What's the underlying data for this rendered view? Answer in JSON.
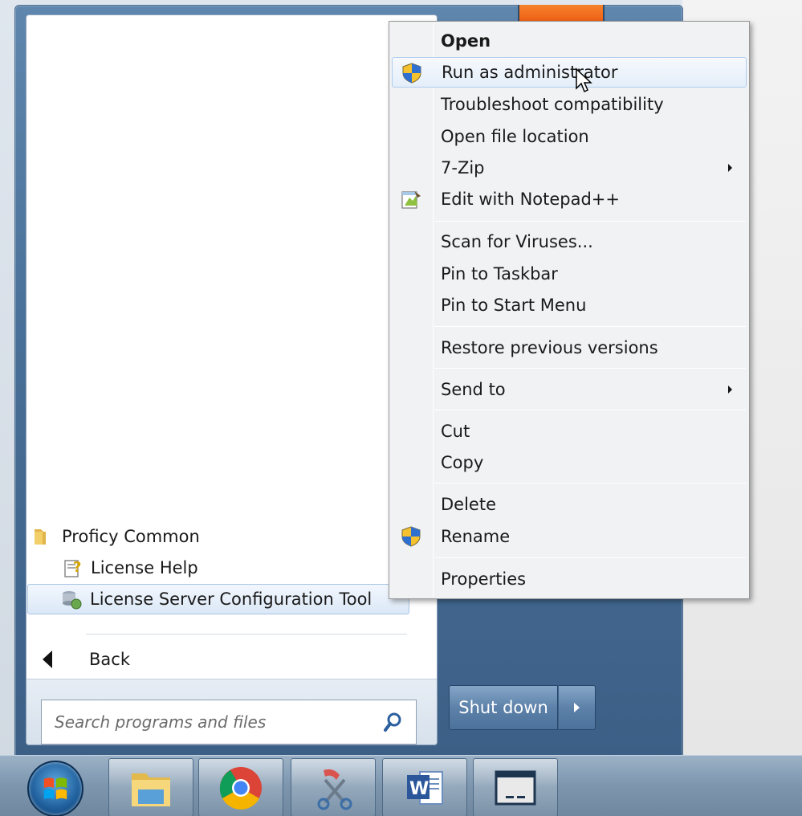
{
  "start_menu": {
    "programs": [
      {
        "label": "Proficy Common",
        "icon": "folder-icon"
      },
      {
        "label": "License Help",
        "icon": "help-file-icon"
      },
      {
        "label": "License Server Configuration Tool",
        "icon": "license-server-icon",
        "selected": true
      }
    ],
    "back_label": "Back",
    "search": {
      "placeholder": "Search programs and files"
    },
    "shutdown_label": "Shut down"
  },
  "context_menu": {
    "items": [
      {
        "label": "Open",
        "bold": true
      },
      {
        "label": "Run as administrator",
        "icon": "uac-shield-icon",
        "hovered": true
      },
      {
        "label": "Troubleshoot compatibility"
      },
      {
        "label": "Open file location"
      },
      {
        "label": "7-Zip",
        "submenu": true
      },
      {
        "label": "Edit with Notepad++",
        "icon": "notepad-plus-plus-icon"
      },
      {
        "label": "Scan for Viruses..."
      },
      {
        "label": "Pin to Taskbar"
      },
      {
        "label": "Pin to Start Menu"
      },
      {
        "label": "Restore previous versions"
      },
      {
        "label": "Send to",
        "submenu": true
      },
      {
        "label": "Cut"
      },
      {
        "label": "Copy"
      },
      {
        "label": "Delete"
      },
      {
        "label": "Rename",
        "icon": "uac-shield-icon"
      },
      {
        "label": "Properties"
      }
    ]
  },
  "taskbar": {
    "buttons": [
      "windows-explorer-icon",
      "chrome-icon",
      "snipping-tool-icon",
      "word-icon",
      "window-app-icon"
    ]
  },
  "colors": {
    "accent": "#4c729b",
    "hover": "#e4eef9",
    "menu_bg": "#f1f2f4"
  }
}
